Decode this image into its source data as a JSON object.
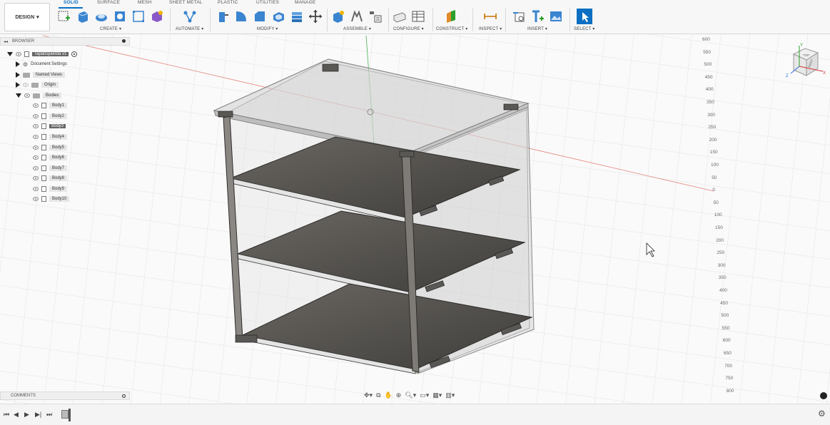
{
  "toolbar": {
    "workspace_label": "DESIGN",
    "tabs": [
      "SOLID",
      "SURFACE",
      "MESH",
      "SHEET METAL",
      "PLASTIC",
      "UTILITIES",
      "MANAGE"
    ],
    "groups": [
      "CREATE ▾",
      "AUTOMATE ▾",
      "MODIFY ▾",
      "ASSEMBLE ▾",
      "CONFIGURE ▾",
      "CONSTRUCT ▾",
      "INSPECT ▾",
      "INSERT ▾",
      "SELECT ▾"
    ]
  },
  "browser": {
    "title": "BROWSER",
    "root": "Tapalzquierda v1",
    "items": {
      "doc_settings": "Document Settings",
      "named_views": "Named Views",
      "origin": "Origin",
      "bodies": "Bodies"
    },
    "bodies": [
      "Body1",
      "Body2",
      "Body3",
      "Body4",
      "Body5",
      "Body6",
      "Body7",
      "Body8",
      "Body9",
      "Body10"
    ],
    "selected_body": "Body3"
  },
  "comments": {
    "title": "COMMENTS"
  },
  "ruler": [
    "600",
    "550",
    "500",
    "450",
    "400",
    "350",
    "300",
    "250",
    "200",
    "150",
    "100",
    "50",
    "0",
    "50",
    "100",
    "150",
    "200",
    "250",
    "300",
    "350",
    "400",
    "450",
    "500",
    "550",
    "600",
    "650",
    "700",
    "750",
    "800"
  ],
  "viewcube": {
    "top": "TOP",
    "right": "RIGHT",
    "axes": [
      "Y",
      "X",
      "Z"
    ]
  },
  "colors": {
    "accent": "#0a6fc2",
    "shelf": "#5b5853",
    "glass": "#dcdcdc"
  }
}
